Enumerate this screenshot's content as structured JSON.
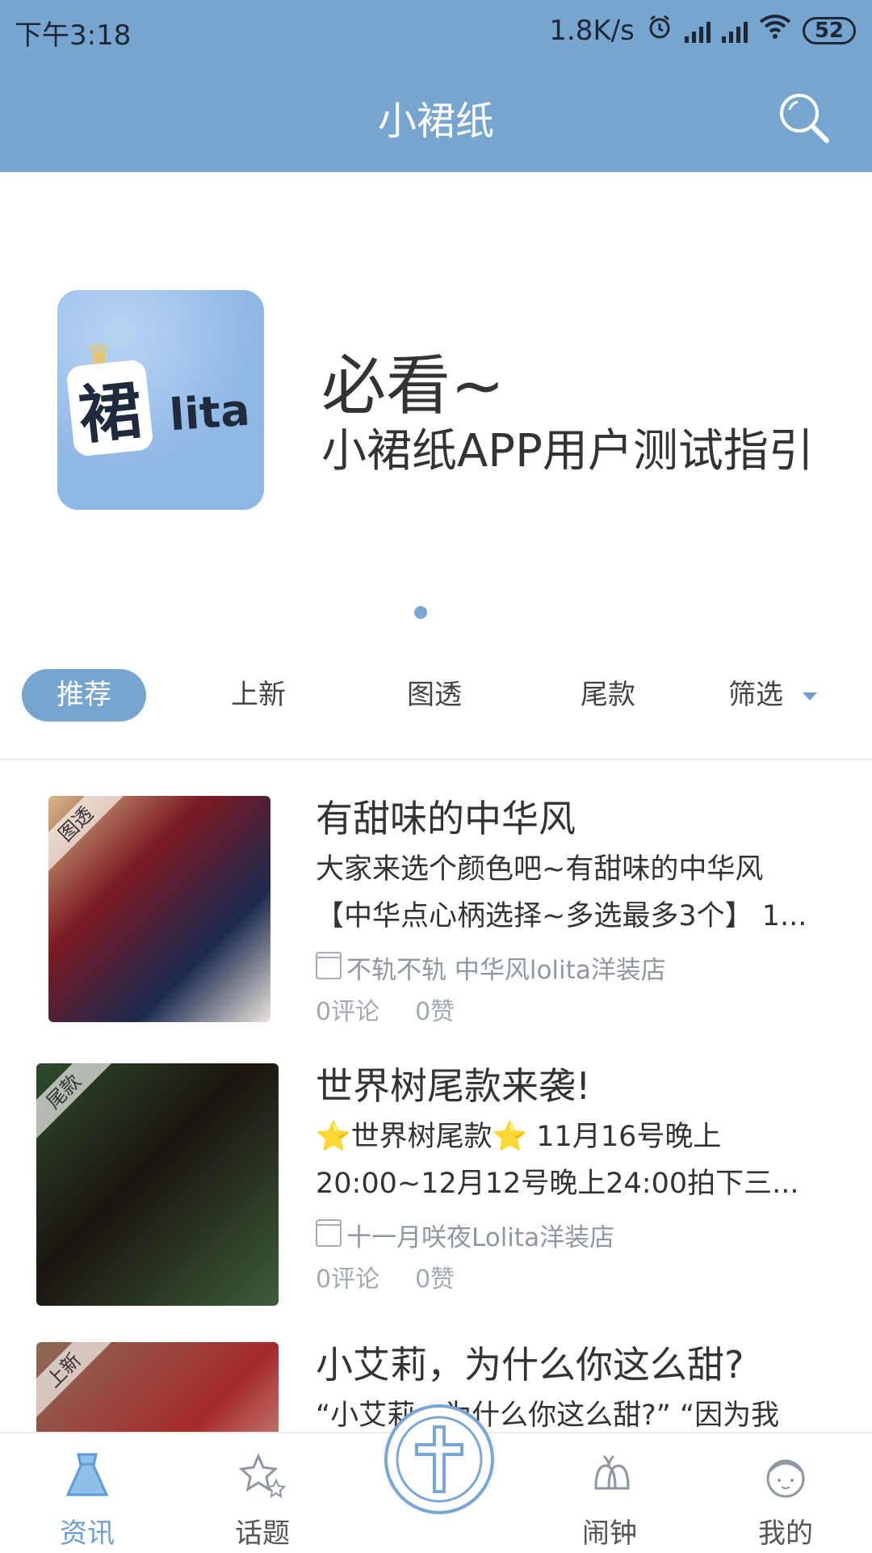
{
  "status_bar": {
    "time": "下午3:18",
    "speed": "1.8K/s",
    "battery": "52"
  },
  "app_bar": {
    "title": "小裙纸"
  },
  "banner": {
    "logo_text": "裙",
    "logo_sub": "lita",
    "title_line1": "必看~",
    "title_line2": "小裙纸APP用户测试指引"
  },
  "tabs": [
    "推荐",
    "上新",
    "图透",
    "尾款",
    "筛选"
  ],
  "posts": [
    {
      "tag": "图透",
      "title": "有甜味的中华风",
      "desc_line1": "大家来选个颜色吧~有甜味的中华风",
      "desc_line2": "【中华点心柄选择~多选最多3个】 1...",
      "shop": "不轨不轨 中华风lolita洋装店",
      "comments": "0评论",
      "likes": "0赞"
    },
    {
      "tag": "尾款",
      "title": "世界树尾款来袭!",
      "desc_line1": "⭐世界树尾款⭐ 11月16号晚上",
      "desc_line2": "20:00~12月12号晚上24:00拍下三...",
      "shop": "十一月咲夜Lolita洋装店",
      "comments": "0评论",
      "likes": "0赞"
    },
    {
      "tag": "上新",
      "title": "小艾莉，为什么你这么甜?",
      "desc_line1": "“小艾莉，为什么你这么甜?” “因为我"
    }
  ],
  "bottom_nav": [
    {
      "label": "资讯",
      "icon": "dress-icon"
    },
    {
      "label": "话题",
      "icon": "stars-icon"
    },
    {
      "label": "",
      "icon": "cross-icon"
    },
    {
      "label": "闹钟",
      "icon": "bell-icon"
    },
    {
      "label": "我的",
      "icon": "girl-avatar-icon"
    }
  ],
  "colors": {
    "primary": "#78a5d0",
    "text": "#333333",
    "muted": "#8f97a3"
  }
}
